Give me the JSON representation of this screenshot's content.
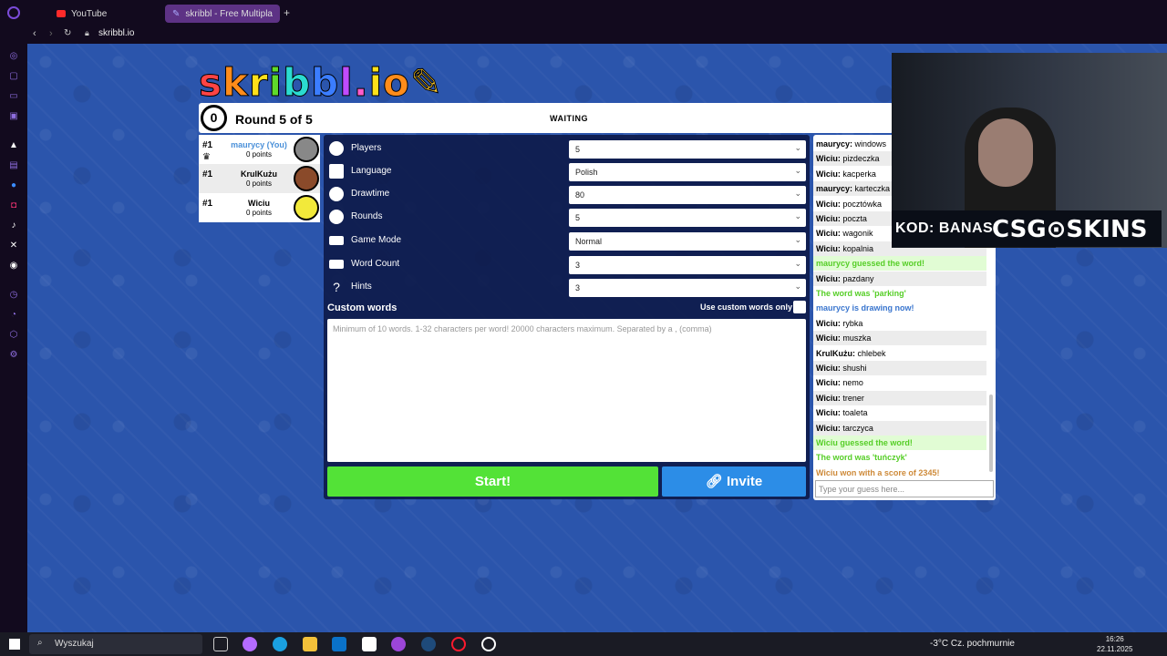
{
  "browser": {
    "tabs": [
      {
        "label": "YouTube"
      },
      {
        "label": "skribbl - Free Multiplayer"
      }
    ],
    "url": "skribbl.io"
  },
  "logo": "skribbl.io",
  "header": {
    "timer": "0",
    "round": "Round 5 of 5",
    "status": "WAITING"
  },
  "players": [
    {
      "rank": "#1",
      "name": "maurycy (You)",
      "points": "0 points",
      "avatar_color": "#888888"
    },
    {
      "rank": "#1",
      "name": "KrulKużu",
      "points": "0 points",
      "avatar_color": "#8a4a2a"
    },
    {
      "rank": "#1",
      "name": "Wiciu",
      "points": "0 points",
      "avatar_color": "#f2e93a"
    }
  ],
  "settings": {
    "rows": [
      {
        "label": "Players",
        "value": "5"
      },
      {
        "label": "Language",
        "value": "Polish"
      },
      {
        "label": "Drawtime",
        "value": "80"
      },
      {
        "label": "Rounds",
        "value": "5"
      },
      {
        "label": "Game Mode",
        "value": "Normal"
      },
      {
        "label": "Word Count",
        "value": "3"
      },
      {
        "label": "Hints",
        "value": "3"
      }
    ],
    "custom_words_title": "Custom words",
    "custom_words_checkbox": "Use custom words only",
    "custom_words_placeholder": "Minimum of 10 words. 1-32 characters per word! 20000 characters maximum. Separated by a , (comma)",
    "start_label": "Start!",
    "invite_label": "Invite"
  },
  "chat": {
    "messages": [
      {
        "user": "maurycy",
        "text": "windows"
      },
      {
        "user": "Wiciu",
        "text": "pizdeczka"
      },
      {
        "user": "Wiciu",
        "text": "kacperka"
      },
      {
        "user": "maurycy",
        "text": "karteczka"
      },
      {
        "user": "Wiciu",
        "text": "pocztówka"
      },
      {
        "user": "Wiciu",
        "text": "poczta"
      },
      {
        "user": "Wiciu",
        "text": "wagonik"
      },
      {
        "user": "Wiciu",
        "text": "kopalnia"
      },
      {
        "system": "maurycy guessed the word!"
      },
      {
        "user": "Wiciu",
        "text": "pazdany"
      },
      {
        "system": "The word was 'parking'"
      },
      {
        "system": "maurycy is drawing now!"
      },
      {
        "user": "Wiciu",
        "text": "rybka"
      },
      {
        "user": "Wiciu",
        "text": "muszka"
      },
      {
        "user": "KrulKużu",
        "text": "chlebek"
      },
      {
        "user": "Wiciu",
        "text": "shushi"
      },
      {
        "user": "Wiciu",
        "text": "nemo"
      },
      {
        "user": "Wiciu",
        "text": "trener"
      },
      {
        "user": "Wiciu",
        "text": "toaleta"
      },
      {
        "user": "Wiciu",
        "text": "tarczyca"
      },
      {
        "system": "Wiciu guessed the word!"
      },
      {
        "system": "The word was 'tuńczyk'"
      },
      {
        "system": "Wiciu won with a score of 2345!"
      }
    ],
    "input_placeholder": "Type your guess here..."
  },
  "promo": {
    "code": "KOD: BANAS",
    "brand": "CSG⊙SKINS"
  },
  "taskbar": {
    "search": "Wyszukaj",
    "weather": "-3°C  Cz. pochmurnie",
    "time": "16:26",
    "date": "22.11.2025"
  },
  "colors": {
    "game_bg": "#2b55ac",
    "start": "#53e237",
    "invite": "#2c8de7",
    "tab_active": "#5d3285"
  }
}
